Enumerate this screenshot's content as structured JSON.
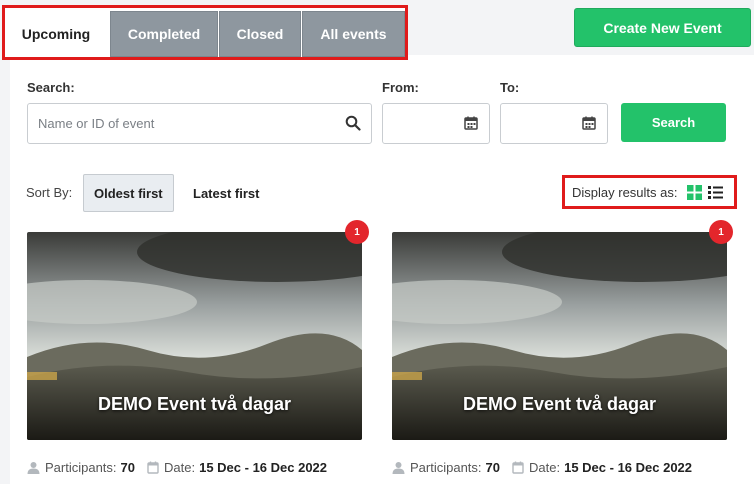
{
  "tabs": [
    {
      "label": "Upcoming",
      "active": true
    },
    {
      "label": "Completed",
      "active": false
    },
    {
      "label": "Closed",
      "active": false
    },
    {
      "label": "All events",
      "active": false
    }
  ],
  "create_button": "Create New Event",
  "search": {
    "label": "Search:",
    "placeholder": "Name or ID of event",
    "from_label": "From:",
    "to_label": "To:",
    "button": "Search"
  },
  "sort": {
    "label": "Sort By:",
    "options": [
      "Oldest first",
      "Latest first"
    ],
    "selected": "Oldest first"
  },
  "display": {
    "label": "Display results as:",
    "icons": [
      "grid-icon",
      "list-icon"
    ]
  },
  "events": [
    {
      "title": "DEMO Event två dagar",
      "badge": "1",
      "participants_label": "Participants:",
      "participants": "70",
      "date_label": "Date:",
      "date": "15 Dec - 16 Dec 2022"
    },
    {
      "title": "DEMO Event två dagar",
      "badge": "1",
      "participants_label": "Participants:",
      "participants": "70",
      "date_label": "Date:",
      "date": "15 Dec - 16 Dec 2022"
    }
  ],
  "colors": {
    "accent_green": "#23c26a",
    "highlight_red": "#e01b1b",
    "badge_red": "#e3262c",
    "tab_inactive": "#8e979f"
  }
}
